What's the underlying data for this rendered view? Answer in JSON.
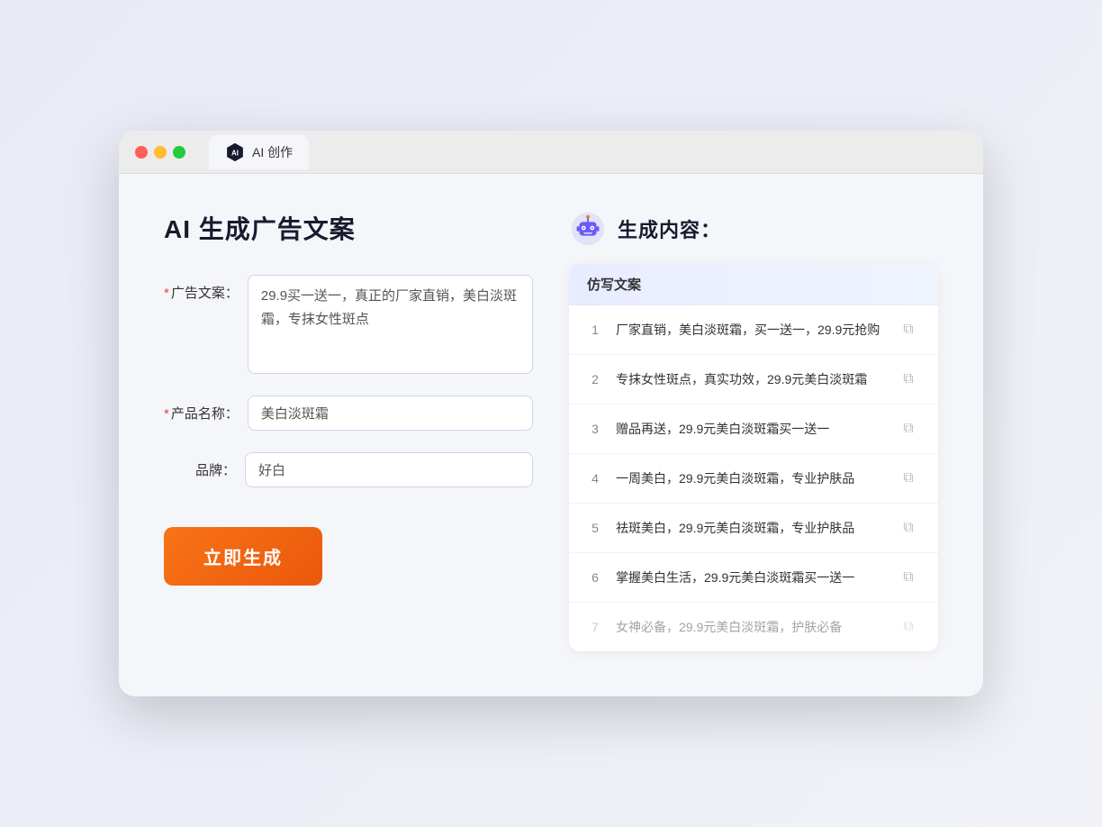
{
  "browser": {
    "tab_label": "AI 创作",
    "traffic_lights": [
      "red",
      "yellow",
      "green"
    ]
  },
  "left_panel": {
    "title": "AI 生成广告文案",
    "form": {
      "ad_copy": {
        "label": "广告文案：",
        "required": true,
        "value": "29.9买一送一，真正的厂家直销，美白淡斑霜，专抹女性斑点",
        "placeholder": ""
      },
      "product_name": {
        "label": "产品名称：",
        "required": true,
        "value": "美白淡斑霜",
        "placeholder": ""
      },
      "brand": {
        "label": "品牌：",
        "required": false,
        "value": "好白",
        "placeholder": ""
      }
    },
    "generate_button": "立即生成"
  },
  "right_panel": {
    "title": "生成内容：",
    "results_header": "仿写文案",
    "results": [
      {
        "num": 1,
        "text": "厂家直销，美白淡斑霜，买一送一，29.9元抢购",
        "dimmed": false
      },
      {
        "num": 2,
        "text": "专抹女性斑点，真实功效，29.9元美白淡斑霜",
        "dimmed": false
      },
      {
        "num": 3,
        "text": "赠品再送，29.9元美白淡斑霜买一送一",
        "dimmed": false
      },
      {
        "num": 4,
        "text": "一周美白，29.9元美白淡斑霜，专业护肤品",
        "dimmed": false
      },
      {
        "num": 5,
        "text": "祛斑美白，29.9元美白淡斑霜，专业护肤品",
        "dimmed": false
      },
      {
        "num": 6,
        "text": "掌握美白生活，29.9元美白淡斑霜买一送一",
        "dimmed": false
      },
      {
        "num": 7,
        "text": "女神必备，29.9元美白淡斑霜，护肤必备",
        "dimmed": true
      }
    ]
  }
}
